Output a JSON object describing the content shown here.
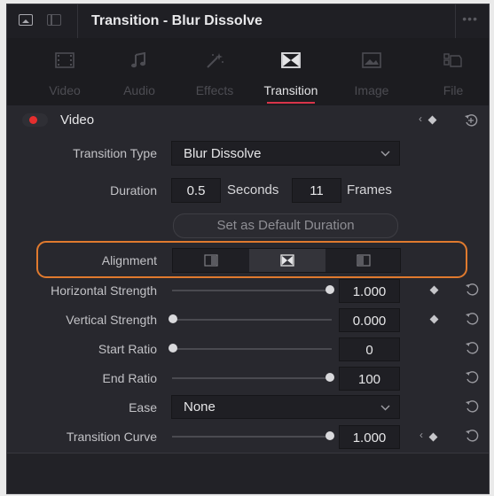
{
  "header": {
    "title": "Transition - Blur Dissolve"
  },
  "tabs": [
    {
      "label": "Video"
    },
    {
      "label": "Audio"
    },
    {
      "label": "Effects"
    },
    {
      "label": "Transition"
    },
    {
      "label": "Image"
    },
    {
      "label": "File"
    }
  ],
  "section": {
    "title": "Video",
    "enabled": true
  },
  "fields": {
    "transition_type": {
      "label": "Transition Type",
      "value": "Blur Dissolve"
    },
    "duration": {
      "label": "Duration",
      "seconds": "0.5",
      "seconds_unit": "Seconds",
      "frames": "11",
      "frames_unit": "Frames"
    },
    "default_button": "Set as Default Duration",
    "alignment": {
      "label": "Alignment",
      "selected": "center"
    },
    "horizontal_strength": {
      "label": "Horizontal Strength",
      "value": "1.000",
      "level": 1.0
    },
    "vertical_strength": {
      "label": "Vertical Strength",
      "value": "0.000",
      "level": 0.0
    },
    "start_ratio": {
      "label": "Start Ratio",
      "value": "0",
      "level": 0.0
    },
    "end_ratio": {
      "label": "End Ratio",
      "value": "100",
      "level": 1.0
    },
    "ease": {
      "label": "Ease",
      "value": "None"
    },
    "transition_curve": {
      "label": "Transition Curve",
      "value": "1.000",
      "level": 1.0
    }
  },
  "colors": {
    "accent": "#d8344a",
    "highlight_outline": "#e07a2e",
    "toggle_on": "#e52e2e"
  },
  "icons": [
    "video-tab-icon",
    "audio-tab-icon",
    "effects-tab-icon",
    "transition-tab-icon",
    "image-tab-icon",
    "file-tab-icon",
    "keyframe-icon",
    "reset-icon",
    "chevron-down-icon"
  ]
}
